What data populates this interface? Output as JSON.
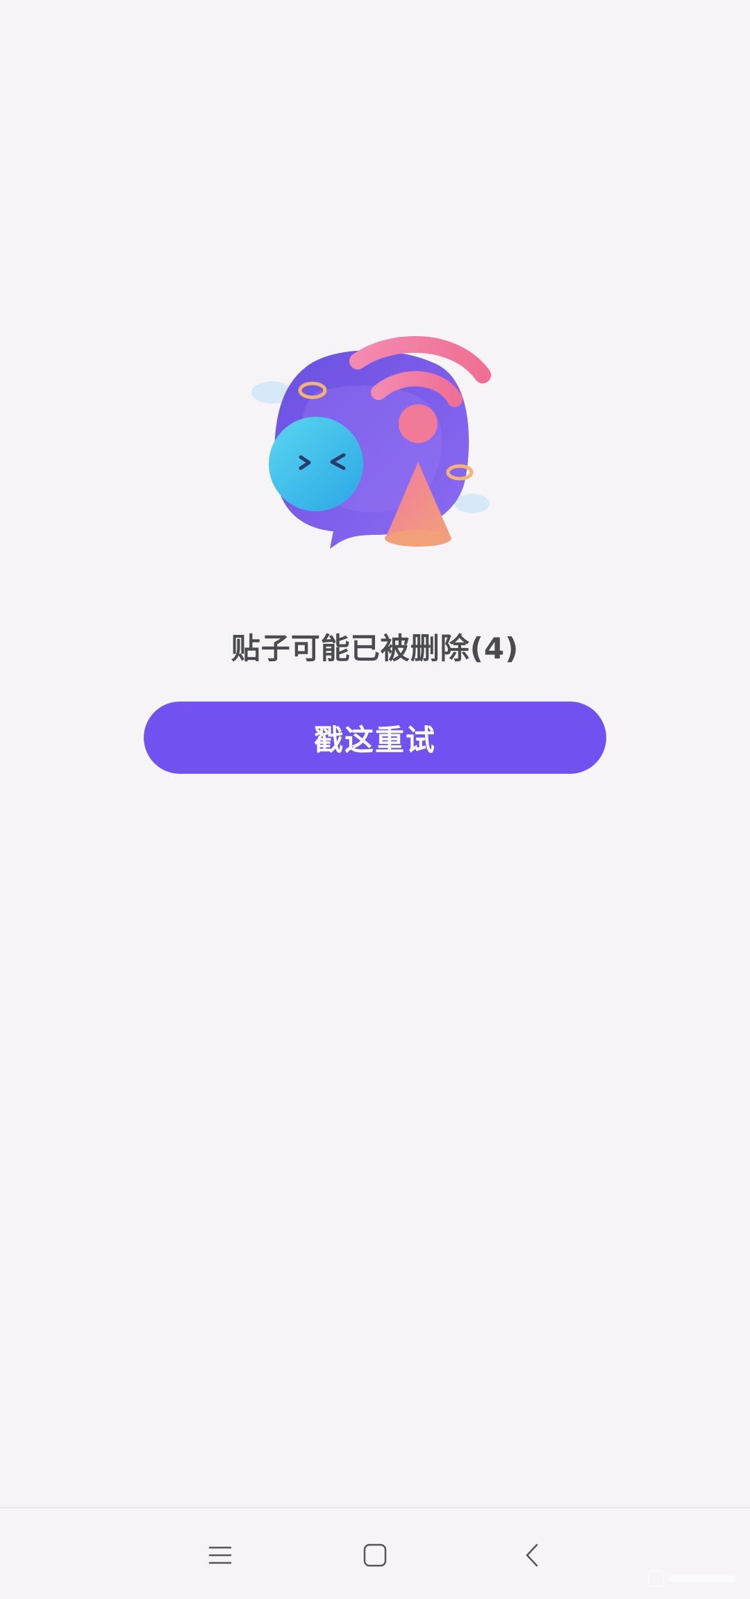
{
  "error": {
    "message": "贴子可能已被删除(4)"
  },
  "retry": {
    "label": "戳这重试"
  },
  "navigation": {
    "items": [
      "menu",
      "home",
      "back"
    ]
  },
  "colors": {
    "accent": "#7152f0",
    "background": "#f6f4f7",
    "text": "#4a4a4f"
  }
}
